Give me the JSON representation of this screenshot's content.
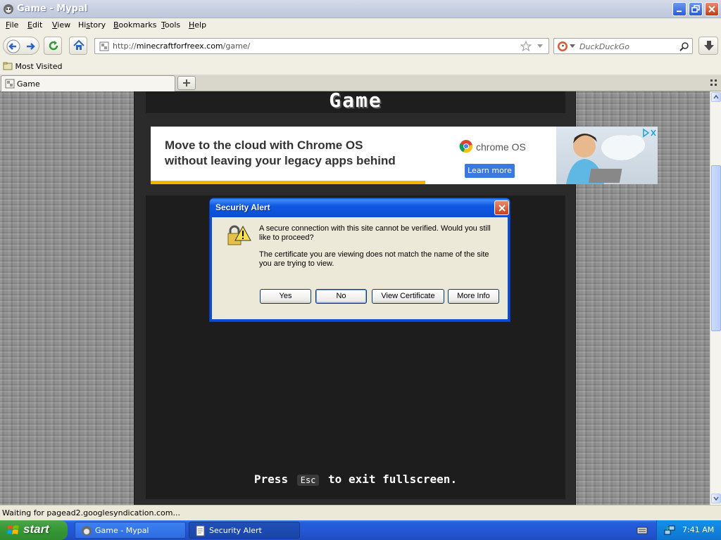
{
  "window": {
    "title": "Game - Mypal"
  },
  "menu": [
    "File",
    "Edit",
    "View",
    "History",
    "Bookmarks",
    "Tools",
    "Help"
  ],
  "menu_mnemonics": [
    "F",
    "E",
    "V",
    "S",
    "B",
    "T",
    "H"
  ],
  "address": {
    "scheme": "http://",
    "domain": "minecraftforfreex.com",
    "path": "/game/"
  },
  "search": {
    "placeholder": "DuckDuckGo"
  },
  "bookmarks": {
    "most_visited": "Most Visited"
  },
  "tabs": [
    {
      "label": "Game"
    }
  ],
  "page": {
    "header": "Game",
    "fullscreen": {
      "before": "Press",
      "key": "Esc",
      "after": "to exit fullscreen."
    }
  },
  "ad": {
    "headline_line1": "Move to the cloud with Chrome OS",
    "headline_line2": "without leaving your legacy apps behind",
    "brand": "chrome OS",
    "cta": "Learn more"
  },
  "dialog": {
    "title": "Security Alert",
    "message1": "A secure connection with this site cannot be verified. Would you still like to proceed?",
    "message2": "The certificate you are viewing does not match the name of the site you are trying to view.",
    "buttons": {
      "yes": "Yes",
      "no": "No",
      "view_cert": "View Certificate",
      "more_info": "More Info"
    }
  },
  "status": {
    "text": "Waiting for pagead2.googlesyndication.com..."
  },
  "taskbar": {
    "start": "start",
    "tasks": [
      {
        "label": "Game - Mypal"
      },
      {
        "label": "Security Alert"
      }
    ],
    "clock": "7:41 AM"
  },
  "colors": {
    "titlebar_active": "#0b4ed4",
    "taskbar": "#245edb",
    "start_green": "#379a37",
    "ad_accent": "#f3b400",
    "ad_button": "#3a7ae0"
  }
}
